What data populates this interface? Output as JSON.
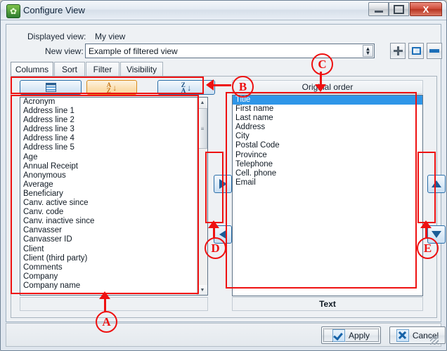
{
  "window": {
    "title": "Configure View",
    "app_icon": "leaf-icon",
    "controls": {
      "minimize": "minimize-icon",
      "maximize": "restore-icon",
      "close": "X"
    }
  },
  "header": {
    "displayed_view_label": "Displayed view:",
    "displayed_view_value": "My view",
    "new_view_label": "New view:",
    "new_view_value": "Example of filtered view",
    "add_button": "add-view-button",
    "rename_button": "rename-view-button",
    "remove_button": "remove-view-button"
  },
  "tabs": [
    {
      "label": "Columns",
      "selected": true
    },
    {
      "label": "Sort",
      "selected": false
    },
    {
      "label": "Filter",
      "selected": false
    },
    {
      "label": "Visibility",
      "selected": false
    }
  ],
  "left_panel": {
    "toolbar": [
      {
        "name": "original-order-button",
        "icon": "grid-list-icon",
        "style": "blue"
      },
      {
        "name": "sort-ascending-button",
        "icon": "a-z-down-icon",
        "top": "A",
        "bottom": "Z",
        "arrow": "↓",
        "style": "orange"
      },
      {
        "name": "sort-descending-button",
        "icon": "z-a-down-icon",
        "top": "Z",
        "bottom": "A",
        "arrow": "↓",
        "style": "blue"
      }
    ],
    "items": [
      "Acronym",
      "Address line 1",
      "Address line 2",
      "Address line 3",
      "Address line 4",
      "Address line 5",
      "Age",
      "Annual Receipt",
      "Anonymous",
      "Average",
      "Beneficiary",
      "Canv. active since",
      "Canv. code",
      "Canv. inactive since",
      "Canvasser",
      "Canvasser ID",
      "Client",
      "Client (third party)",
      "Comments",
      "Company",
      "Company name"
    ]
  },
  "middle_buttons": [
    {
      "name": "move-right-button",
      "icon": "triangle-right-icon"
    },
    {
      "name": "move-left-button",
      "icon": "triangle-left-icon"
    }
  ],
  "right_panel": {
    "header": "Original order",
    "footer": "Text",
    "items": [
      {
        "label": "Title",
        "selected": true
      },
      {
        "label": "First name",
        "selected": false
      },
      {
        "label": "Last name",
        "selected": false
      },
      {
        "label": "Address",
        "selected": false
      },
      {
        "label": "City",
        "selected": false
      },
      {
        "label": "Postal Code",
        "selected": false
      },
      {
        "label": "Province",
        "selected": false
      },
      {
        "label": "Telephone",
        "selected": false
      },
      {
        "label": "Cell. phone",
        "selected": false
      },
      {
        "label": "Email",
        "selected": false
      }
    ]
  },
  "order_buttons": [
    {
      "name": "move-up-button",
      "icon": "triangle-up-icon"
    },
    {
      "name": "move-down-button",
      "icon": "triangle-down-icon"
    }
  ],
  "footer": {
    "apply_label": "Apply",
    "cancel_label": "Cancel"
  },
  "annotations": [
    {
      "id": "A",
      "label": "A",
      "target": "available-columns-list"
    },
    {
      "id": "B",
      "label": "B",
      "target": "left-list-toolbar"
    },
    {
      "id": "C",
      "label": "C",
      "target": "selected-columns-header"
    },
    {
      "id": "D",
      "label": "D",
      "target": "move-buttons"
    },
    {
      "id": "E",
      "label": "E",
      "target": "order-buttons"
    }
  ],
  "colors": {
    "annotation": "#ee1111",
    "selection": "#2f96e8",
    "accent_blue": "#2a6ea8",
    "accent_orange": "#d98b1c"
  }
}
